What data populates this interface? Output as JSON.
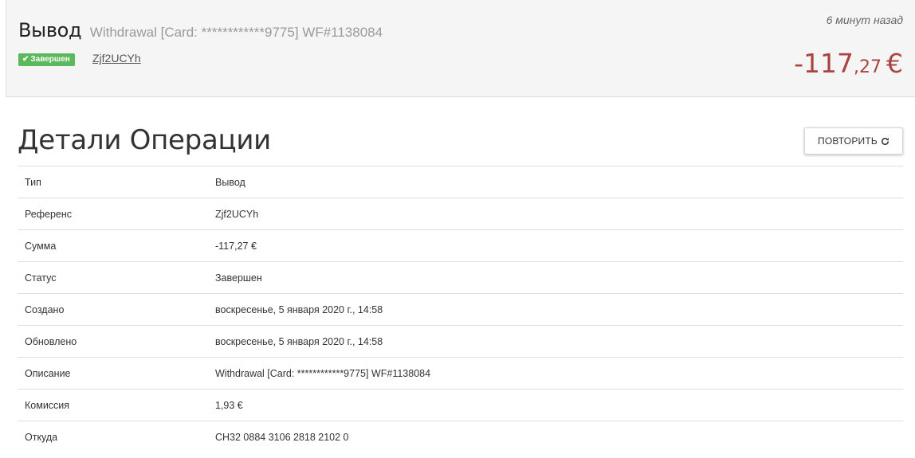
{
  "header": {
    "title": "Вывод",
    "description": "Withdrawal [Card: ************9775] WF#1138084",
    "status_badge": "Завершен",
    "reference": "Zjf2UCYh",
    "time_ago": "6 минут назад",
    "amount_int": "-117",
    "amount_dec": ",27",
    "amount_currency": "€",
    "amount_color": "#a94442",
    "badge_color": "#5cb85c"
  },
  "details": {
    "title": "Детали Операции",
    "repeat_button": "ПОВТОРИТЬ",
    "repeat_icon": "refresh-icon",
    "rows": [
      {
        "label": "Тип",
        "value": "Вывод"
      },
      {
        "label": "Референс",
        "value": "Zjf2UCYh"
      },
      {
        "label": "Сумма",
        "value": "-117,27 €"
      },
      {
        "label": "Статус",
        "value": "Завершен"
      },
      {
        "label": "Создано",
        "value": "воскресенье, 5 января 2020 г., 14:58"
      },
      {
        "label": "Обновлено",
        "value": "воскресенье, 5 января 2020 г., 14:58"
      },
      {
        "label": "Описание",
        "value": "Withdrawal [Card: ************9775] WF#1138084"
      },
      {
        "label": "Комиссия",
        "value": "1,93 €"
      },
      {
        "label": "Откуда",
        "value": "CH32 0884 3106 2818 2102 0"
      }
    ]
  }
}
